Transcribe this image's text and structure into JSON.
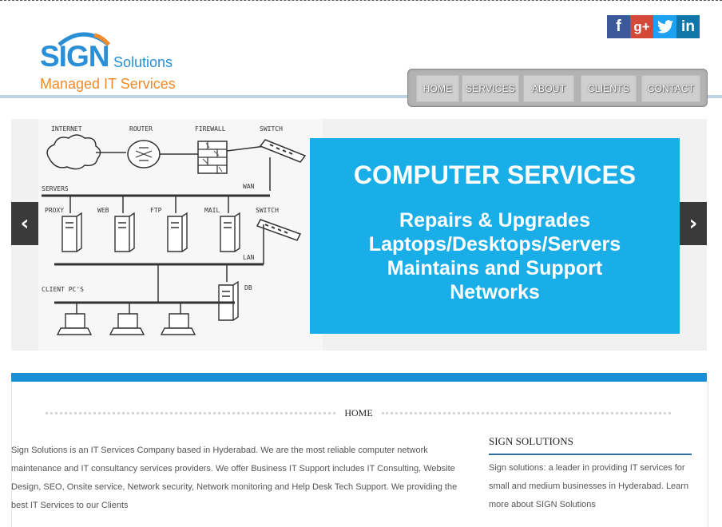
{
  "brand": {
    "name": "SIGN",
    "suffix": "Solutions",
    "tagline": "Managed IT Services",
    "colors": {
      "primary": "#2b8fd6",
      "accent": "#f08a2a"
    }
  },
  "social": {
    "facebook": "f",
    "google_plus": "g+",
    "twitter": "twitter-bird",
    "linkedin": "in"
  },
  "nav": {
    "items": [
      {
        "label": "HOME"
      },
      {
        "label": "SERVICES"
      },
      {
        "label": "ABOUT"
      },
      {
        "label": "CLIENTS"
      },
      {
        "label": "CONTACT"
      }
    ]
  },
  "slider": {
    "diagram_labels": {
      "internet": "INTERNET",
      "router": "ROUTER",
      "firewall": "FIREWALL",
      "switch_top": "SWITCH",
      "wan": "WAN",
      "servers": "SERVERS",
      "proxy": "PROXY",
      "web": "WEB",
      "ftp": "FTP",
      "mail": "MAIL",
      "switch_mid": "SWITCH",
      "lan": "LAN",
      "client_pcs": "CLIENT PC'S",
      "db": "DB"
    },
    "title": "COMPUTER SERVICES",
    "lines": [
      "Repairs & Upgrades",
      "Laptops/Desktops/Servers",
      "Maintains and Support",
      "Networks"
    ],
    "prev_icon": "‹",
    "next_icon": "›",
    "promo_color": "#1aaee8"
  },
  "content": {
    "section_title": "HOME",
    "intro": "Sign Solutions is an IT Services Company based in Hyderabad. We are the most reliable computer network maintenance and IT consultancy services providers. We offer Business IT Support includes IT Consulting, Website Design, SEO, Onsite service, Network security, Network monitoring and Help Desk Tech Support. We providing the best IT Services to our Clients",
    "sidebar_title": "SIGN SOLUTIONS",
    "sidebar_text": "Sign solutions: a leader in providing IT services for small and medium businesses in Hyderabad. Learn more about SIGN Solutions"
  }
}
